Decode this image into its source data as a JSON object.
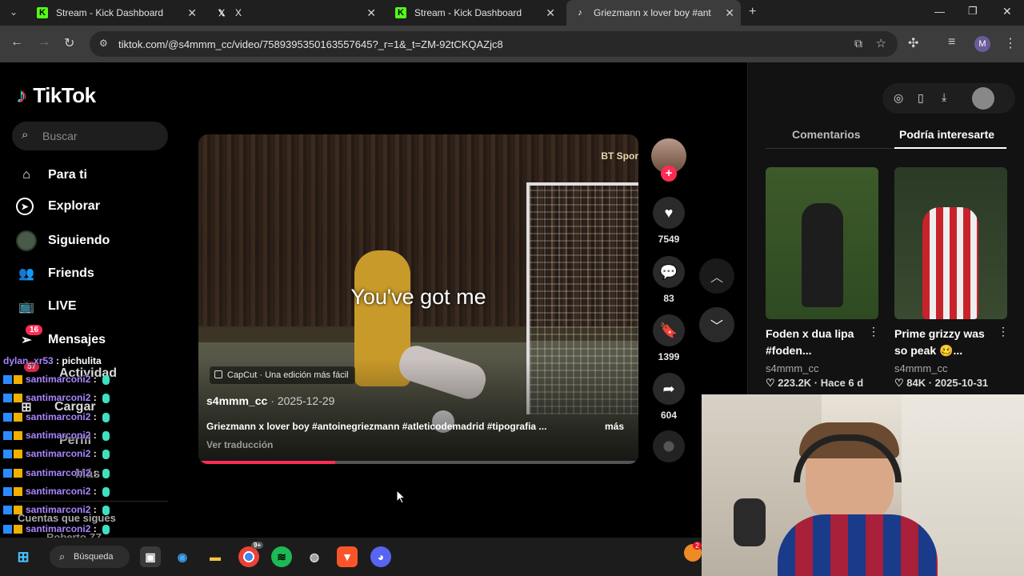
{
  "browser": {
    "tabs": [
      {
        "title": "Stream - Kick Dashboard",
        "icon": "kick-icon"
      },
      {
        "title": "X",
        "icon": "x-icon"
      },
      {
        "title": "Stream - Kick Dashboard",
        "icon": "kick-icon"
      },
      {
        "title": "Griezmann x lover boy #ant",
        "icon": "tiktok-icon"
      }
    ],
    "new_tab": "+",
    "url": "tiktok.com/@s4mmm_cc/video/7589395350163557645?_r=1&_t=ZM-92tCKQAZjc8",
    "profile_initial": "M"
  },
  "tiktok": {
    "logo": "TikTok",
    "search_placeholder": "Buscar",
    "nav": [
      {
        "label": "Para ti",
        "icon": "home-icon"
      },
      {
        "label": "Explorar",
        "icon": "compass-icon"
      },
      {
        "label": "Siguiendo",
        "icon": "following-avatar-icon"
      },
      {
        "label": "Friends",
        "icon": "friends-icon"
      },
      {
        "label": "LIVE",
        "icon": "live-icon"
      },
      {
        "label": "Mensajes",
        "icon": "messages-icon",
        "badge": "16"
      },
      {
        "label": "Actividad",
        "icon": "activity-icon",
        "badge": "57"
      },
      {
        "label": "Cargar",
        "icon": "upload-icon"
      },
      {
        "label": "Perfil",
        "icon": "profile-icon"
      },
      {
        "label": "Más",
        "icon": "more-icon"
      }
    ],
    "following_header": "Cuentas que sigues",
    "following_partial": "Roberto ZZ",
    "video": {
      "lyric": "You've got me",
      "watermark": "BT Spor",
      "capcut_label": "CapCut · Una edición más fácil",
      "author": "s4mmm_cc",
      "date": "· 2025-12-29",
      "caption": "Griezmann x lover boy #antoinegriezmann #atleticodemadrid #tipografia ...",
      "more": "más",
      "translate": "Ver traducción",
      "progress": 0.31
    },
    "actions": {
      "likes": "7549",
      "comments": "83",
      "saves": "1399",
      "shares": "604"
    },
    "right_panel": {
      "tabs": [
        "Comentarios",
        "Podría interesarte"
      ],
      "active_tab": "Podría interesarte",
      "videos": [
        {
          "title": "Foden x dua lipa #foden...",
          "user": "s4mmm_cc",
          "stats": "♡ 223.2K · Hace 6 d"
        },
        {
          "title": "Prime grizzy was so peak 🥴...",
          "user": "s4mmm_cc",
          "stats": "♡ 84K · 2025-10-31"
        }
      ]
    }
  },
  "chat": [
    {
      "user": "dylan_xr53",
      "msg": " : pichulita"
    },
    {
      "user": "santimarconi2",
      "msg": " : "
    },
    {
      "user": "santimarconi2",
      "msg": " : "
    },
    {
      "user": "santimarconi2",
      "msg": " : "
    },
    {
      "user": "santimarconi2",
      "msg": " : "
    },
    {
      "user": "santimarconi2",
      "msg": " : "
    },
    {
      "user": "santimarconi2",
      "msg": " : "
    },
    {
      "user": "santimarconi2",
      "msg": " : "
    },
    {
      "user": "santimarconi2",
      "msg": " : "
    },
    {
      "user": "santimarconi2",
      "msg": " : "
    },
    {
      "user": "santimarconi2",
      "msg": " : "
    }
  ],
  "taskbar": {
    "search_label": "Búsqueda",
    "notification_badge": "2",
    "chrome_badge": "9+"
  },
  "colors": {
    "tiktok_red": "#fe2c55",
    "kick_green": "#53fc18",
    "chat_user": "#a985ff"
  }
}
